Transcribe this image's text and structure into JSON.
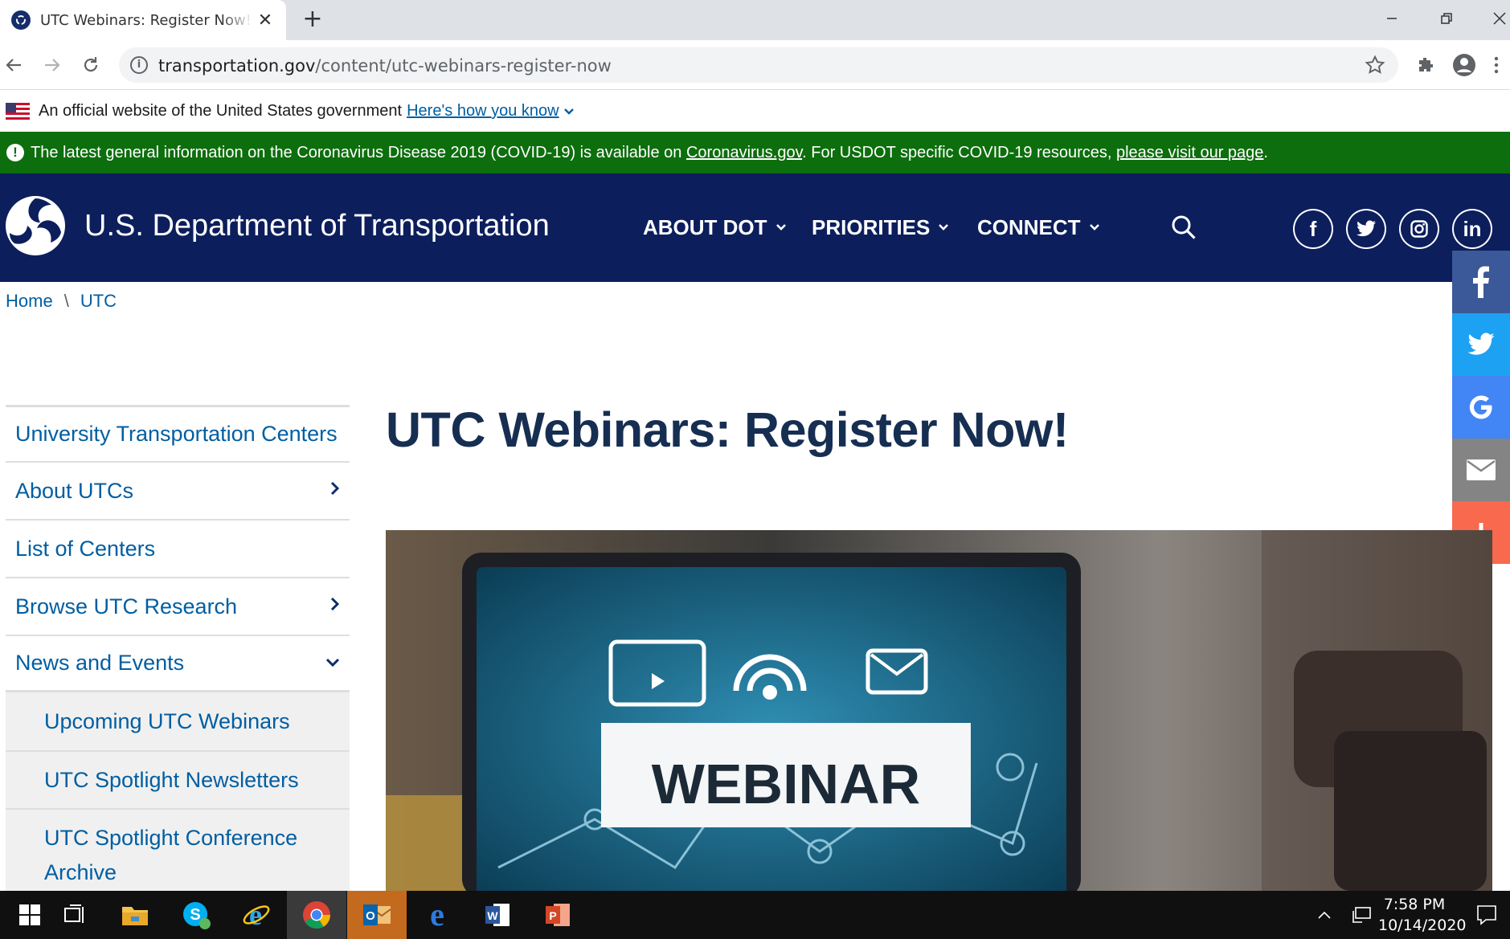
{
  "browser": {
    "tab_title": "UTC Webinars: Register Now! | US Department of Transportation",
    "url_domain": "transportation.gov",
    "url_path": "/content/utc-webinars-register-now"
  },
  "gov_banner": {
    "text": "An official website of the United States government",
    "link": "Here's how you know"
  },
  "alert": {
    "text_before": "The latest general information on the Coronavirus Disease 2019 (COVID-19) is available on ",
    "link1": "Coronavirus.gov",
    "text_middle": ". For USDOT specific COVID-19 resources, ",
    "link2": "please visit our page",
    "text_after": ".",
    "color": "#0d6e0d"
  },
  "header": {
    "site_title": "U.S. Department of Transportation",
    "nav": [
      "ABOUT DOT",
      "PRIORITIES",
      "CONNECT"
    ],
    "social": [
      "facebook-icon",
      "twitter-icon",
      "instagram-icon",
      "linkedin-icon"
    ],
    "color": "#0c1e5c"
  },
  "breadcrumb": {
    "home": "Home",
    "current": "UTC"
  },
  "sidenav": {
    "items": [
      "University Transportation Centers",
      "About UTCs",
      "List of Centers",
      "Browse UTC Research",
      "News and Events",
      "Upcoming UTC Webinars",
      "UTC Spotlight Newsletters",
      "UTC Spotlight Conference Archive"
    ]
  },
  "main": {
    "title": "UTC Webinars: Register Now!",
    "hero_text": "WEBINAR"
  },
  "taskbar": {
    "time": "7:58 PM",
    "date": "10/14/2020"
  }
}
